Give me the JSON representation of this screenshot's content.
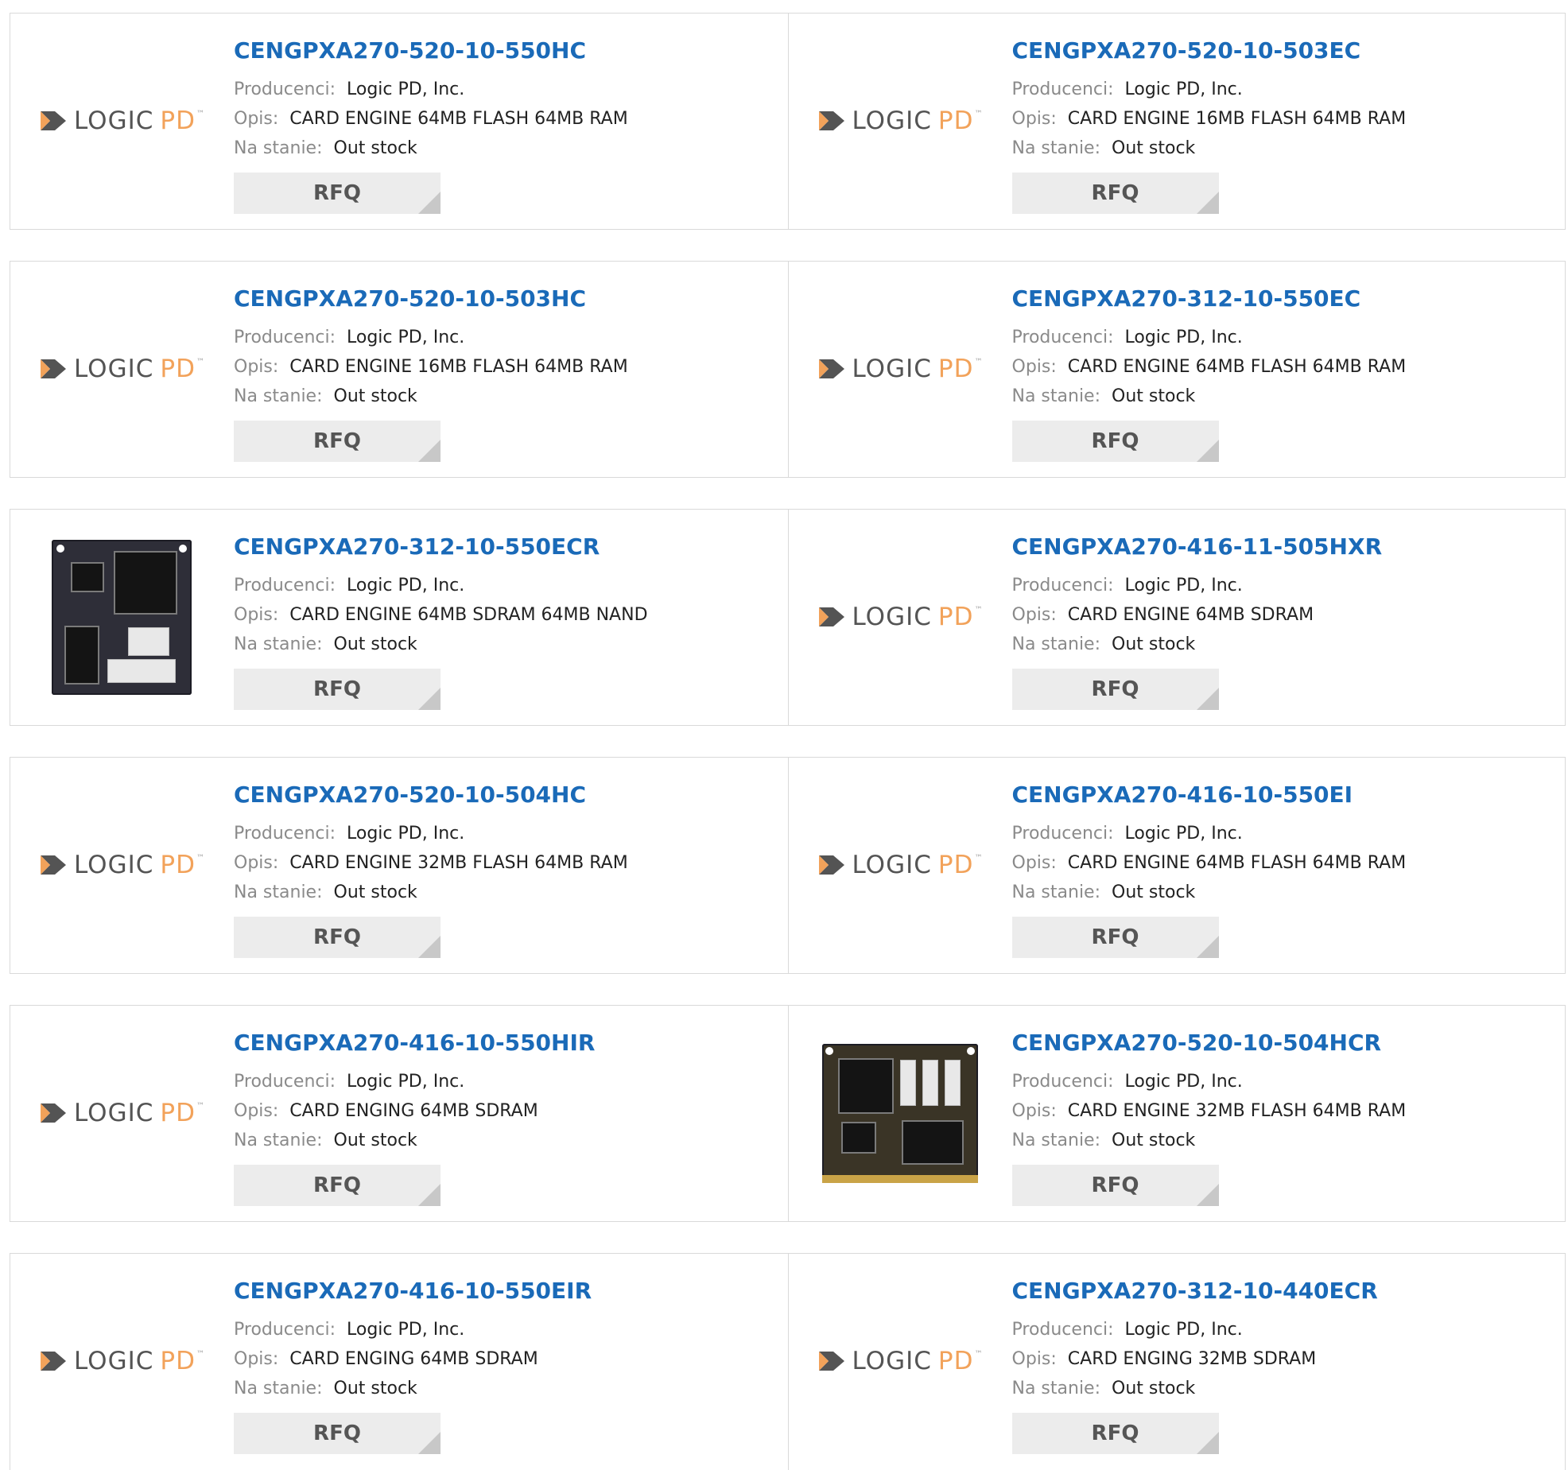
{
  "labels": {
    "manufacturer": "Producenci:",
    "description": "Opis:",
    "stock": "Na stanie:",
    "rfq": "RFQ"
  },
  "logo": {
    "word1": "LOGIC",
    "word2": "PD",
    "tm": "™"
  },
  "colors": {
    "title": "#1a6ab8",
    "label": "#8a8a8a",
    "logo_accent": "#f2a25a",
    "button_bg": "#ececec"
  },
  "products": [
    {
      "part": "CENGPXA270-520-10-550HC",
      "manufacturer": "Logic PD, Inc.",
      "description": "CARD ENGINE 64MB FLASH 64MB RAM",
      "stock": "Out stock",
      "image": "logo"
    },
    {
      "part": "CENGPXA270-520-10-503EC",
      "manufacturer": "Logic PD, Inc.",
      "description": "CARD ENGINE 16MB FLASH 64MB RAM",
      "stock": "Out stock",
      "image": "logo"
    },
    {
      "part": "CENGPXA270-520-10-503HC",
      "manufacturer": "Logic PD, Inc.",
      "description": "CARD ENGINE 16MB FLASH 64MB RAM",
      "stock": "Out stock",
      "image": "logo"
    },
    {
      "part": "CENGPXA270-312-10-550EC",
      "manufacturer": "Logic PD, Inc.",
      "description": "CARD ENGINE 64MB FLASH 64MB RAM",
      "stock": "Out stock",
      "image": "logo"
    },
    {
      "part": "CENGPXA270-312-10-550ECR",
      "manufacturer": "Logic PD, Inc.",
      "description": "CARD ENGINE 64MB SDRAM 64MB NAND",
      "stock": "Out stock",
      "image": "board-a"
    },
    {
      "part": "CENGPXA270-416-11-505HXR",
      "manufacturer": "Logic PD, Inc.",
      "description": "CARD ENGINE 64MB SDRAM",
      "stock": "Out stock",
      "image": "logo"
    },
    {
      "part": "CENGPXA270-520-10-504HC",
      "manufacturer": "Logic PD, Inc.",
      "description": "CARD ENGINE 32MB FLASH 64MB RAM",
      "stock": "Out stock",
      "image": "logo"
    },
    {
      "part": "CENGPXA270-416-10-550EI",
      "manufacturer": "Logic PD, Inc.",
      "description": "CARD ENGINE 64MB FLASH 64MB RAM",
      "stock": "Out stock",
      "image": "logo"
    },
    {
      "part": "CENGPXA270-416-10-550HIR",
      "manufacturer": "Logic PD, Inc.",
      "description": "CARD ENGING 64MB SDRAM",
      "stock": "Out stock",
      "image": "logo"
    },
    {
      "part": "CENGPXA270-520-10-504HCR",
      "manufacturer": "Logic PD, Inc.",
      "description": "CARD ENGINE 32MB FLASH 64MB RAM",
      "stock": "Out stock",
      "image": "board-b"
    },
    {
      "part": "CENGPXA270-416-10-550EIR",
      "manufacturer": "Logic PD, Inc.",
      "description": "CARD ENGING 64MB SDRAM",
      "stock": "Out stock",
      "image": "logo"
    },
    {
      "part": "CENGPXA270-312-10-440ECR",
      "manufacturer": "Logic PD, Inc.",
      "description": "CARD ENGING 32MB SDRAM",
      "stock": "Out stock",
      "image": "logo"
    }
  ]
}
